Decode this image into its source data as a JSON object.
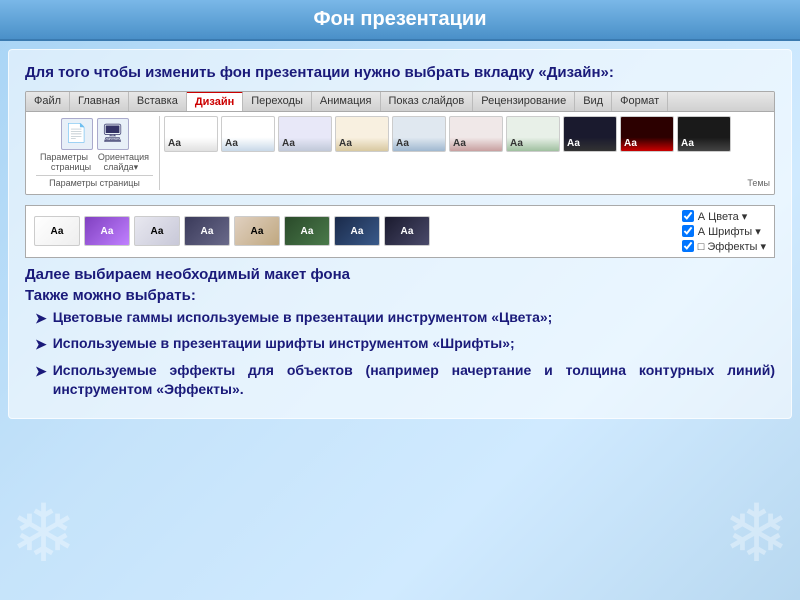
{
  "title": "Фон презентации",
  "intro": "Для того чтобы изменить фон презентации нужно выбрать вкладку «Дизайн»:",
  "ribbon": {
    "tabs": [
      "Файл",
      "Главная",
      "Вставка",
      "Дизайн",
      "Переходы",
      "Анимация",
      "Показ слайдов",
      "Рецензирование",
      "Вид",
      "Формат"
    ],
    "active_tab": "Дизайн",
    "group_label": "Параметры страницы",
    "icon1": "📄",
    "icon2": "🖥",
    "themes_label": "Темы",
    "theme_label": "Аа"
  },
  "second_ribbon": {
    "theme_label": "Аа",
    "options": [
      "Цвета",
      "Шрифты",
      "Эффекты"
    ]
  },
  "section1": "Далее выбираем необходимый макет фона",
  "section2": "Также можно выбрать:",
  "bullets": [
    "Цветовые гаммы используемые в презентации инструментом «Цвета»;",
    "Используемые в презентации шрифты инструментом «Шрифты»;",
    "Используемые эффекты для объектов (например начертание и толщина контурных линий) инструментом «Эффекты»."
  ]
}
